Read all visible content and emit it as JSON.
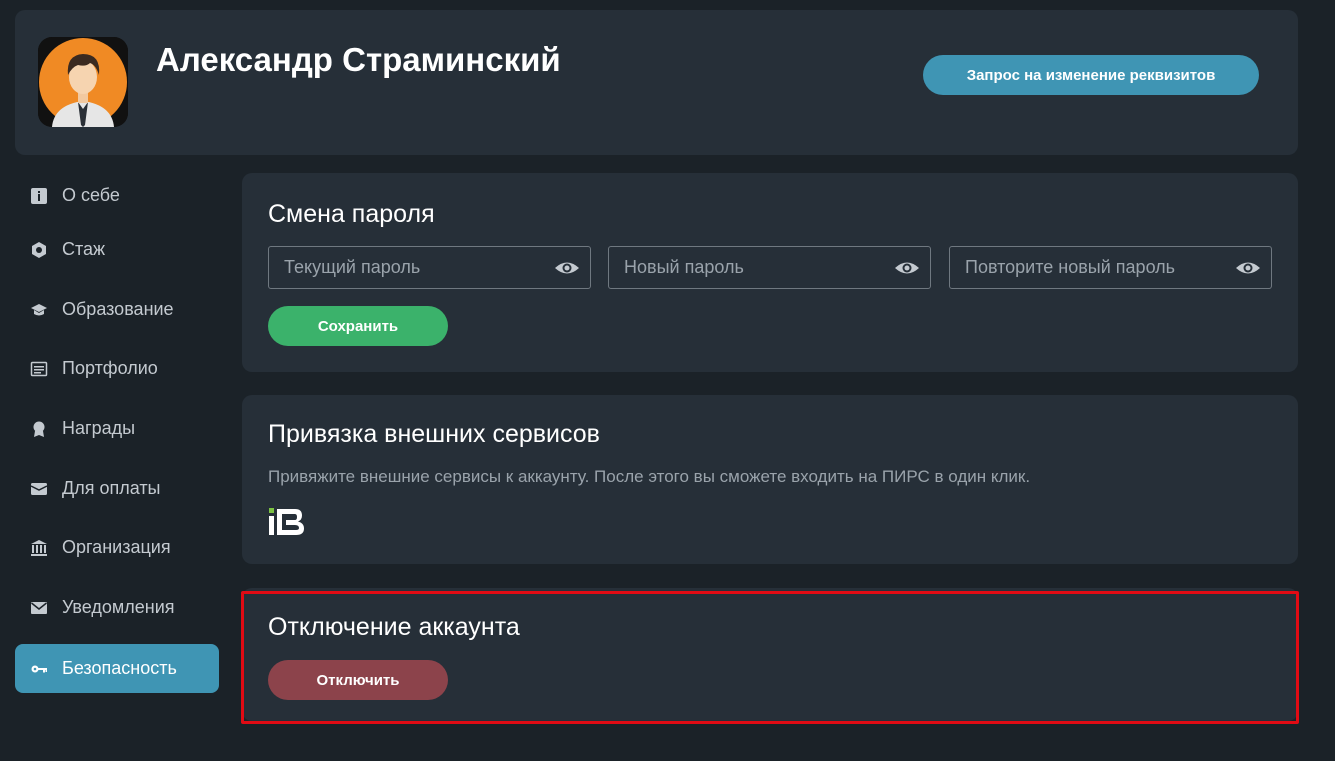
{
  "header": {
    "user_name": "Александр Страминский",
    "request_button": "Запрос на изменение реквизитов",
    "avatar_icon": "user-avatar",
    "avatar_bg": "#f08a24"
  },
  "sidebar": {
    "items": [
      {
        "label": "О себе",
        "icon": "info-icon"
      },
      {
        "label": "Стаж",
        "icon": "hexagon-icon"
      },
      {
        "label": "Образование",
        "icon": "graduation-cap-icon"
      },
      {
        "label": "Портфолио",
        "icon": "list-icon"
      },
      {
        "label": "Награды",
        "icon": "award-icon"
      },
      {
        "label": "Для оплаты",
        "icon": "wallet-icon"
      },
      {
        "label": "Организация",
        "icon": "bank-icon"
      },
      {
        "label": "Уведомления",
        "icon": "envelope-icon"
      },
      {
        "label": "Безопасность",
        "icon": "key-icon",
        "active": true
      }
    ]
  },
  "password_card": {
    "title": "Смена пароля",
    "current_placeholder": "Текущий пароль",
    "new_placeholder": "Новый пароль",
    "repeat_placeholder": "Повторите новый пароль",
    "save_button": "Сохранить"
  },
  "services_card": {
    "title": "Привязка внешних сервисов",
    "description": "Привяжите внешние сервисы к аккаунту. После этого вы сможете входить на ПИРС в один клик.",
    "service_logo": "ib-logo-icon"
  },
  "disable_card": {
    "title": "Отключение аккаунта",
    "disable_button": "Отключить"
  },
  "colors": {
    "background": "#1b2228",
    "card": "#262f38",
    "accent": "#3f95b4",
    "success": "#3bb26b",
    "danger": "#8c434b",
    "highlight": "#e10b14"
  }
}
